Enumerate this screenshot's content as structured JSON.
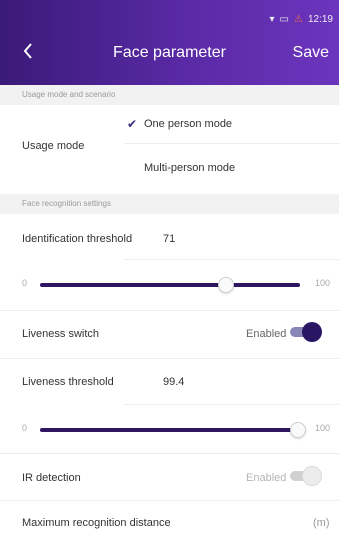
{
  "status_bar": {
    "time": "12:19"
  },
  "header": {
    "title": "Face parameter",
    "save_label": "Save"
  },
  "sections": {
    "usage": "Usage mode and scenario",
    "recognition": "Face recognition settings"
  },
  "usage_mode": {
    "label": "Usage mode",
    "options": [
      {
        "label": "One person mode",
        "selected": true
      },
      {
        "label": "Multi-person mode",
        "selected": false
      }
    ]
  },
  "identification_threshold": {
    "label": "Identification threshold",
    "value": "71",
    "slider": {
      "min": "0",
      "max": "100",
      "value": 71
    }
  },
  "liveness_switch": {
    "label": "Liveness switch",
    "state_label": "Enabled",
    "on": true
  },
  "liveness_threshold": {
    "label": "Liveness threshold",
    "value": "99.4",
    "slider": {
      "min": "0",
      "max": "100",
      "value": 99.4
    }
  },
  "ir_detection": {
    "label": "IR detection",
    "state_label": "Enabled",
    "on": true,
    "disabled": true
  },
  "max_distance": {
    "label": "Maximum recognition distance",
    "unit": "(m)"
  },
  "colors": {
    "header_start": "#3a1a78",
    "header_end": "#6c35bd",
    "accent": "#2a1763"
  }
}
